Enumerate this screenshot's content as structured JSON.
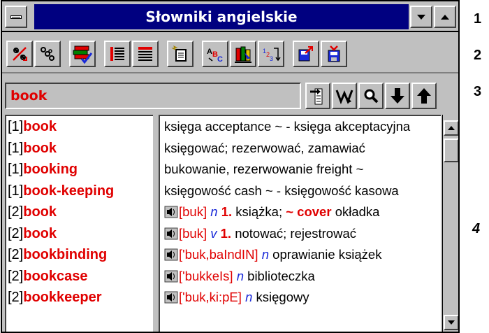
{
  "window": {
    "title": "Słowniki angielskie",
    "system_menu_icon": "minus-icon",
    "minimize_icon": "triangle-down-icon",
    "maximize_icon": "triangle-up-icon"
  },
  "toolbar": {
    "items": [
      {
        "name": "disconnect-icon"
      },
      {
        "name": "link-icon"
      },
      {
        "name": "books-icon"
      },
      {
        "name": "list-red-icon"
      },
      {
        "name": "list-black-icon"
      },
      {
        "name": "new-document-icon"
      },
      {
        "name": "abc-icon"
      },
      {
        "name": "dictionary-icon"
      },
      {
        "name": "sort-123-icon"
      },
      {
        "name": "export-icon"
      },
      {
        "name": "save-icon"
      }
    ]
  },
  "search": {
    "value": "book",
    "buttons": [
      "insert-icon",
      "wildcard-icon",
      "search-icon",
      "arrow-down-icon",
      "arrow-up-icon"
    ]
  },
  "word_list": [
    {
      "prefix": "[1]",
      "word": "book"
    },
    {
      "prefix": "[1]",
      "word": "book"
    },
    {
      "prefix": "[1]",
      "word": "booking"
    },
    {
      "prefix": "[1]",
      "word": "book-keeping"
    },
    {
      "prefix": "[2]",
      "word": "book"
    },
    {
      "prefix": "[2]",
      "word": "book"
    },
    {
      "prefix": "[2]",
      "word": "bookbinding"
    },
    {
      "prefix": "[2]",
      "word": "bookcase"
    },
    {
      "prefix": "[2]",
      "word": "bookkeeper"
    }
  ],
  "definitions": [
    {
      "text": "księga   acceptance ~ - księga akceptacyjna"
    },
    {
      "text": "księgować; rezerwować, zamawiać"
    },
    {
      "text": "bukowanie, rezerwowanie   freight ~"
    },
    {
      "text": "księgowość   cash ~ - księgowość kasowa"
    },
    {
      "phon": "[buk]",
      "pos": "n",
      "sense": "1.",
      "text": "książka;",
      "tilde": "~ cover",
      "rest": "okładka"
    },
    {
      "phon": "[buk]",
      "pos": "v",
      "sense": "1.",
      "text": "notować; rejestrować"
    },
    {
      "phon": "['buk,baIndIN]",
      "pos": "n",
      "text": "oprawianie książek"
    },
    {
      "phon": "['bukkeIs]",
      "pos": "n",
      "text": "biblioteczka"
    },
    {
      "phon": "['buk,ki:pE]",
      "pos": "n",
      "text": "księgowy"
    }
  ],
  "callouts": [
    "1",
    "2",
    "3",
    "4"
  ],
  "colors": {
    "title_bg": "#000080",
    "headword": "#e00000",
    "pos": "#1a2ad8",
    "face": "#c0c0c0"
  }
}
